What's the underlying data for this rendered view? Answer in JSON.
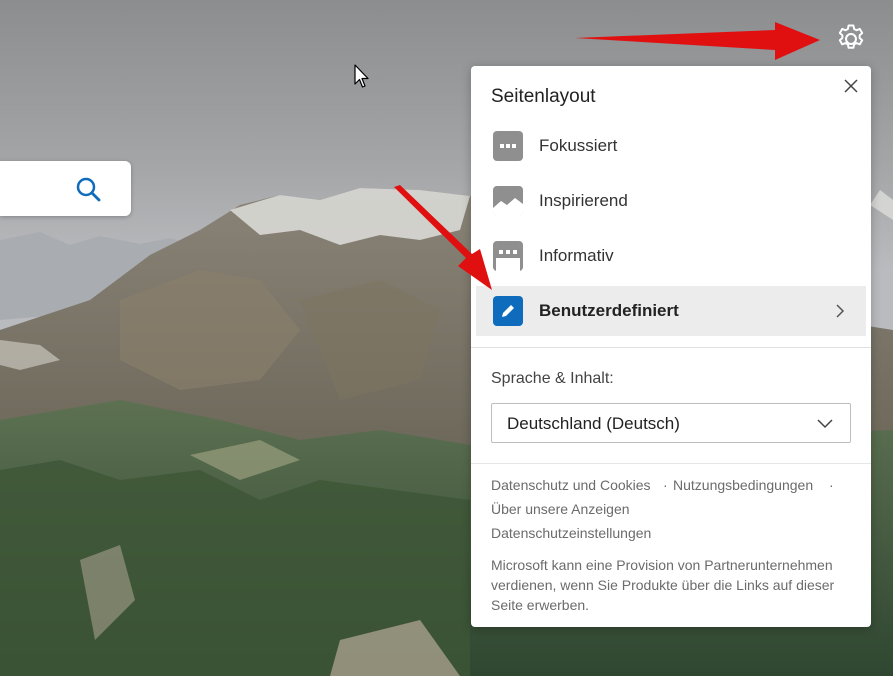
{
  "settings": {
    "icon": "gear-icon"
  },
  "search": {
    "icon": "search-icon"
  },
  "panel": {
    "title": "Seitenlayout",
    "close_icon": "close-icon",
    "layouts": [
      {
        "label": "Fokussiert",
        "icon": "focused-layout-icon"
      },
      {
        "label": "Inspirierend",
        "icon": "inspirational-layout-icon"
      },
      {
        "label": "Informativ",
        "icon": "informational-layout-icon"
      },
      {
        "label": "Benutzerdefiniert",
        "icon": "pencil-icon",
        "selected": true
      }
    ],
    "language_label": "Sprache & Inhalt:",
    "language_value": "Deutschland (Deutsch)",
    "links": {
      "privacy_cookies": "Datenschutz und Cookies",
      "separator": "·",
      "terms": "Nutzungsbedingungen",
      "ads": "Über unsere Anzeigen",
      "privacy_settings": "Datenschutzeinstellungen"
    },
    "disclaimer": "Microsoft kann eine Provision von Partnerunternehmen verdienen, wenn Sie Produkte über die Links auf dieser Seite erwerben."
  },
  "colors": {
    "accent": "#0f6cbd",
    "selected_bg": "#ececec",
    "arrow": "#e01010",
    "icon_gray": "#8f8f8f"
  }
}
